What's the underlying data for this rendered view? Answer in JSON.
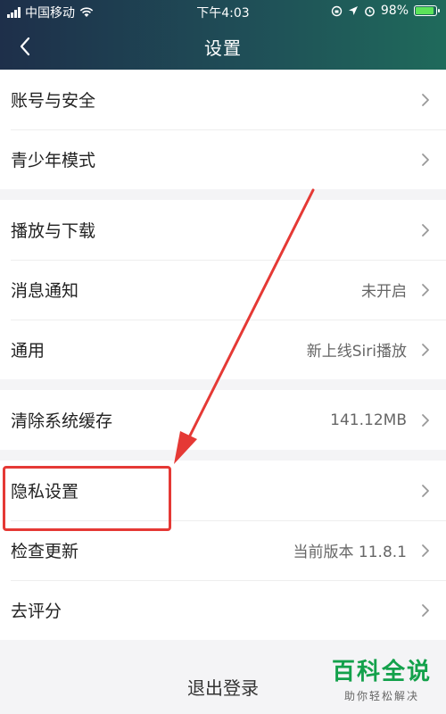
{
  "status_bar": {
    "carrier": "中国移动",
    "time": "下午4:03",
    "battery_percent": "98%",
    "battery_level": 0.98
  },
  "nav": {
    "title": "设置",
    "back_icon": "chevron-left-icon"
  },
  "groups": [
    [
      {
        "label": "账号与安全",
        "value": ""
      },
      {
        "label": "青少年模式",
        "value": ""
      }
    ],
    [
      {
        "label": "播放与下载",
        "value": ""
      },
      {
        "label": "消息通知",
        "value": "未开启"
      },
      {
        "label": "通用",
        "value": "新上线Siri播放"
      }
    ],
    [
      {
        "label": "清除系统缓存",
        "value": "141.12MB"
      }
    ],
    [
      {
        "label": "隐私设置",
        "value": ""
      },
      {
        "label": "检查更新",
        "value": "当前版本 11.8.1"
      },
      {
        "label": "去评分",
        "value": ""
      }
    ]
  ],
  "logout_label": "退出登录",
  "watermark": {
    "main": "百科全说",
    "sub": "助你轻松解决"
  },
  "colors": {
    "header_gradient_start": "#1e2f4a",
    "header_gradient_end": "#1f6a5b",
    "annotation_red": "#e53935",
    "watermark_green": "#13a14b"
  }
}
